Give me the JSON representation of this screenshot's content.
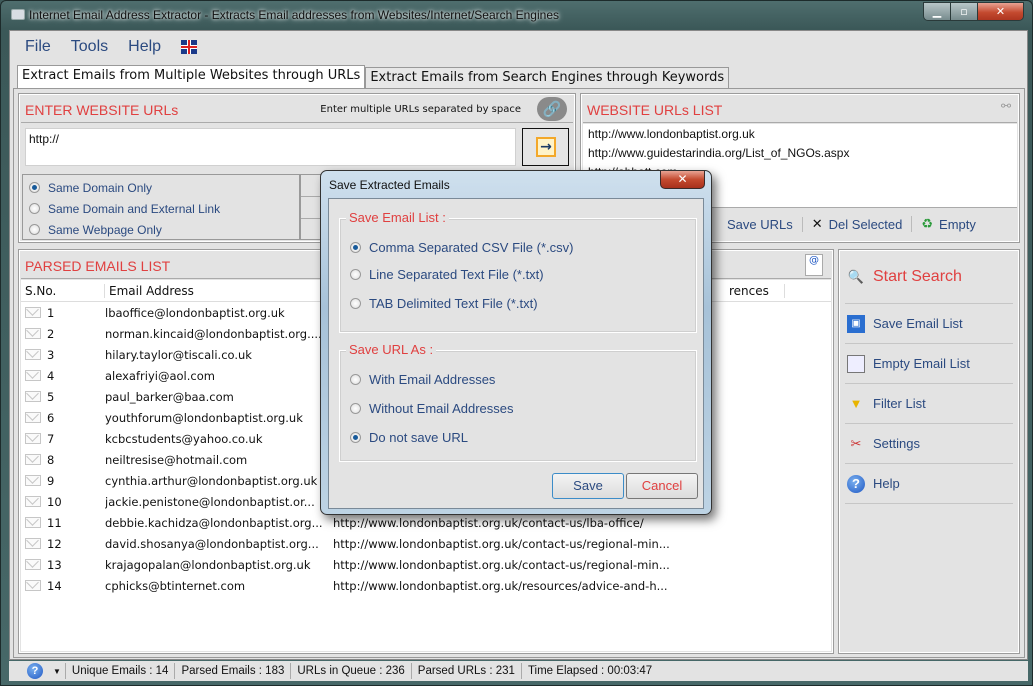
{
  "window": {
    "title": "Internet Email Address Extractor - Extracts Email addresses from Websites/Internet/Search Engines"
  },
  "menu": [
    "File",
    "Tools",
    "Help"
  ],
  "tabs": [
    {
      "label": "Extract Emails from Multiple Websites through URLs",
      "active": true
    },
    {
      "label": "Extract Emails from Search Engines through Keywords",
      "active": false
    }
  ],
  "enter_urls": {
    "title": "ENTER WEBSITE URLs",
    "hint": "Enter multiple URLs separated by space",
    "input_value": "http://",
    "options": [
      {
        "label": "Same Domain Only",
        "selected": true
      },
      {
        "label": "Same Domain and External Link",
        "selected": false
      },
      {
        "label": "Same Webpage Only",
        "selected": false
      }
    ]
  },
  "url_list": {
    "title": "WEBSITE URLs LIST",
    "items": [
      "http://www.londonbaptist.org.uk",
      "http://www.guidestarindia.org/List_of_NGOs.aspx",
      "http://abbott.com"
    ],
    "actions": {
      "save": "Save URLs",
      "delete": "Del Selected",
      "empty": "Empty"
    }
  },
  "parsed": {
    "title": "PARSED EMAILS LIST",
    "columns": [
      "S.No.",
      "Email Address",
      "rences"
    ],
    "rows": [
      {
        "no": "1",
        "email": "lbaoffice@londonbaptist.org.uk",
        "url": ""
      },
      {
        "no": "2",
        "email": "norman.kincaid@londonbaptist.org....",
        "url": ""
      },
      {
        "no": "3",
        "email": "hilary.taylor@tiscali.co.uk",
        "url": ""
      },
      {
        "no": "4",
        "email": "alexafriyi@aol.com",
        "url": ""
      },
      {
        "no": "5",
        "email": "paul_barker@baa.com",
        "url": ""
      },
      {
        "no": "6",
        "email": "youthforum@londonbaptist.org.uk",
        "url": ""
      },
      {
        "no": "7",
        "email": "kcbcstudents@yahoo.co.uk",
        "url": ""
      },
      {
        "no": "8",
        "email": "neiltresise@hotmail.com",
        "url": ""
      },
      {
        "no": "9",
        "email": "cynthia.arthur@londonbaptist.org.uk",
        "url": ""
      },
      {
        "no": "10",
        "email": "jackie.penistone@londonbaptist.or...",
        "url": ""
      },
      {
        "no": "11",
        "email": "debbie.kachidza@londonbaptist.org...",
        "url": "http://www.londonbaptist.org.uk/contact-us/lba-office/"
      },
      {
        "no": "12",
        "email": "david.shosanya@londonbaptist.org...",
        "url": "http://www.londonbaptist.org.uk/contact-us/regional-min..."
      },
      {
        "no": "13",
        "email": "krajagopalan@londonbaptist.org.uk",
        "url": "http://www.londonbaptist.org.uk/contact-us/regional-min..."
      },
      {
        "no": "14",
        "email": "cphicks@btinternet.com",
        "url": "http://www.londonbaptist.org.uk/resources/advice-and-h..."
      }
    ]
  },
  "side": {
    "start": "Start Search",
    "buttons": [
      "Save Email List",
      "Empty Email List",
      "Filter List",
      "Settings",
      "Help"
    ]
  },
  "status": {
    "unique": "Unique Emails :  14",
    "parsed": "Parsed Emails :  183",
    "queue": "URLs in Queue :  236",
    "parsed_urls": "Parsed URLs :  231",
    "elapsed": "Time Elapsed :  00:03:47"
  },
  "dialog": {
    "title": "Save Extracted Emails",
    "group1": "Save Email List :",
    "email_opts": [
      {
        "label": "Comma Separated CSV File (*.csv)",
        "selected": true
      },
      {
        "label": "Line Separated Text File (*.txt)",
        "selected": false
      },
      {
        "label": "TAB Delimited Text File (*.txt)",
        "selected": false
      }
    ],
    "group2": "Save URL As  :",
    "url_opts": [
      {
        "label": "With Email Addresses",
        "selected": false
      },
      {
        "label": "Without Email Addresses",
        "selected": false
      },
      {
        "label": "Do not save URL",
        "selected": true
      }
    ],
    "save": "Save",
    "cancel": "Cancel"
  },
  "colors": {
    "accent_red": "#e04040",
    "label_blue": "#2b4a80"
  }
}
